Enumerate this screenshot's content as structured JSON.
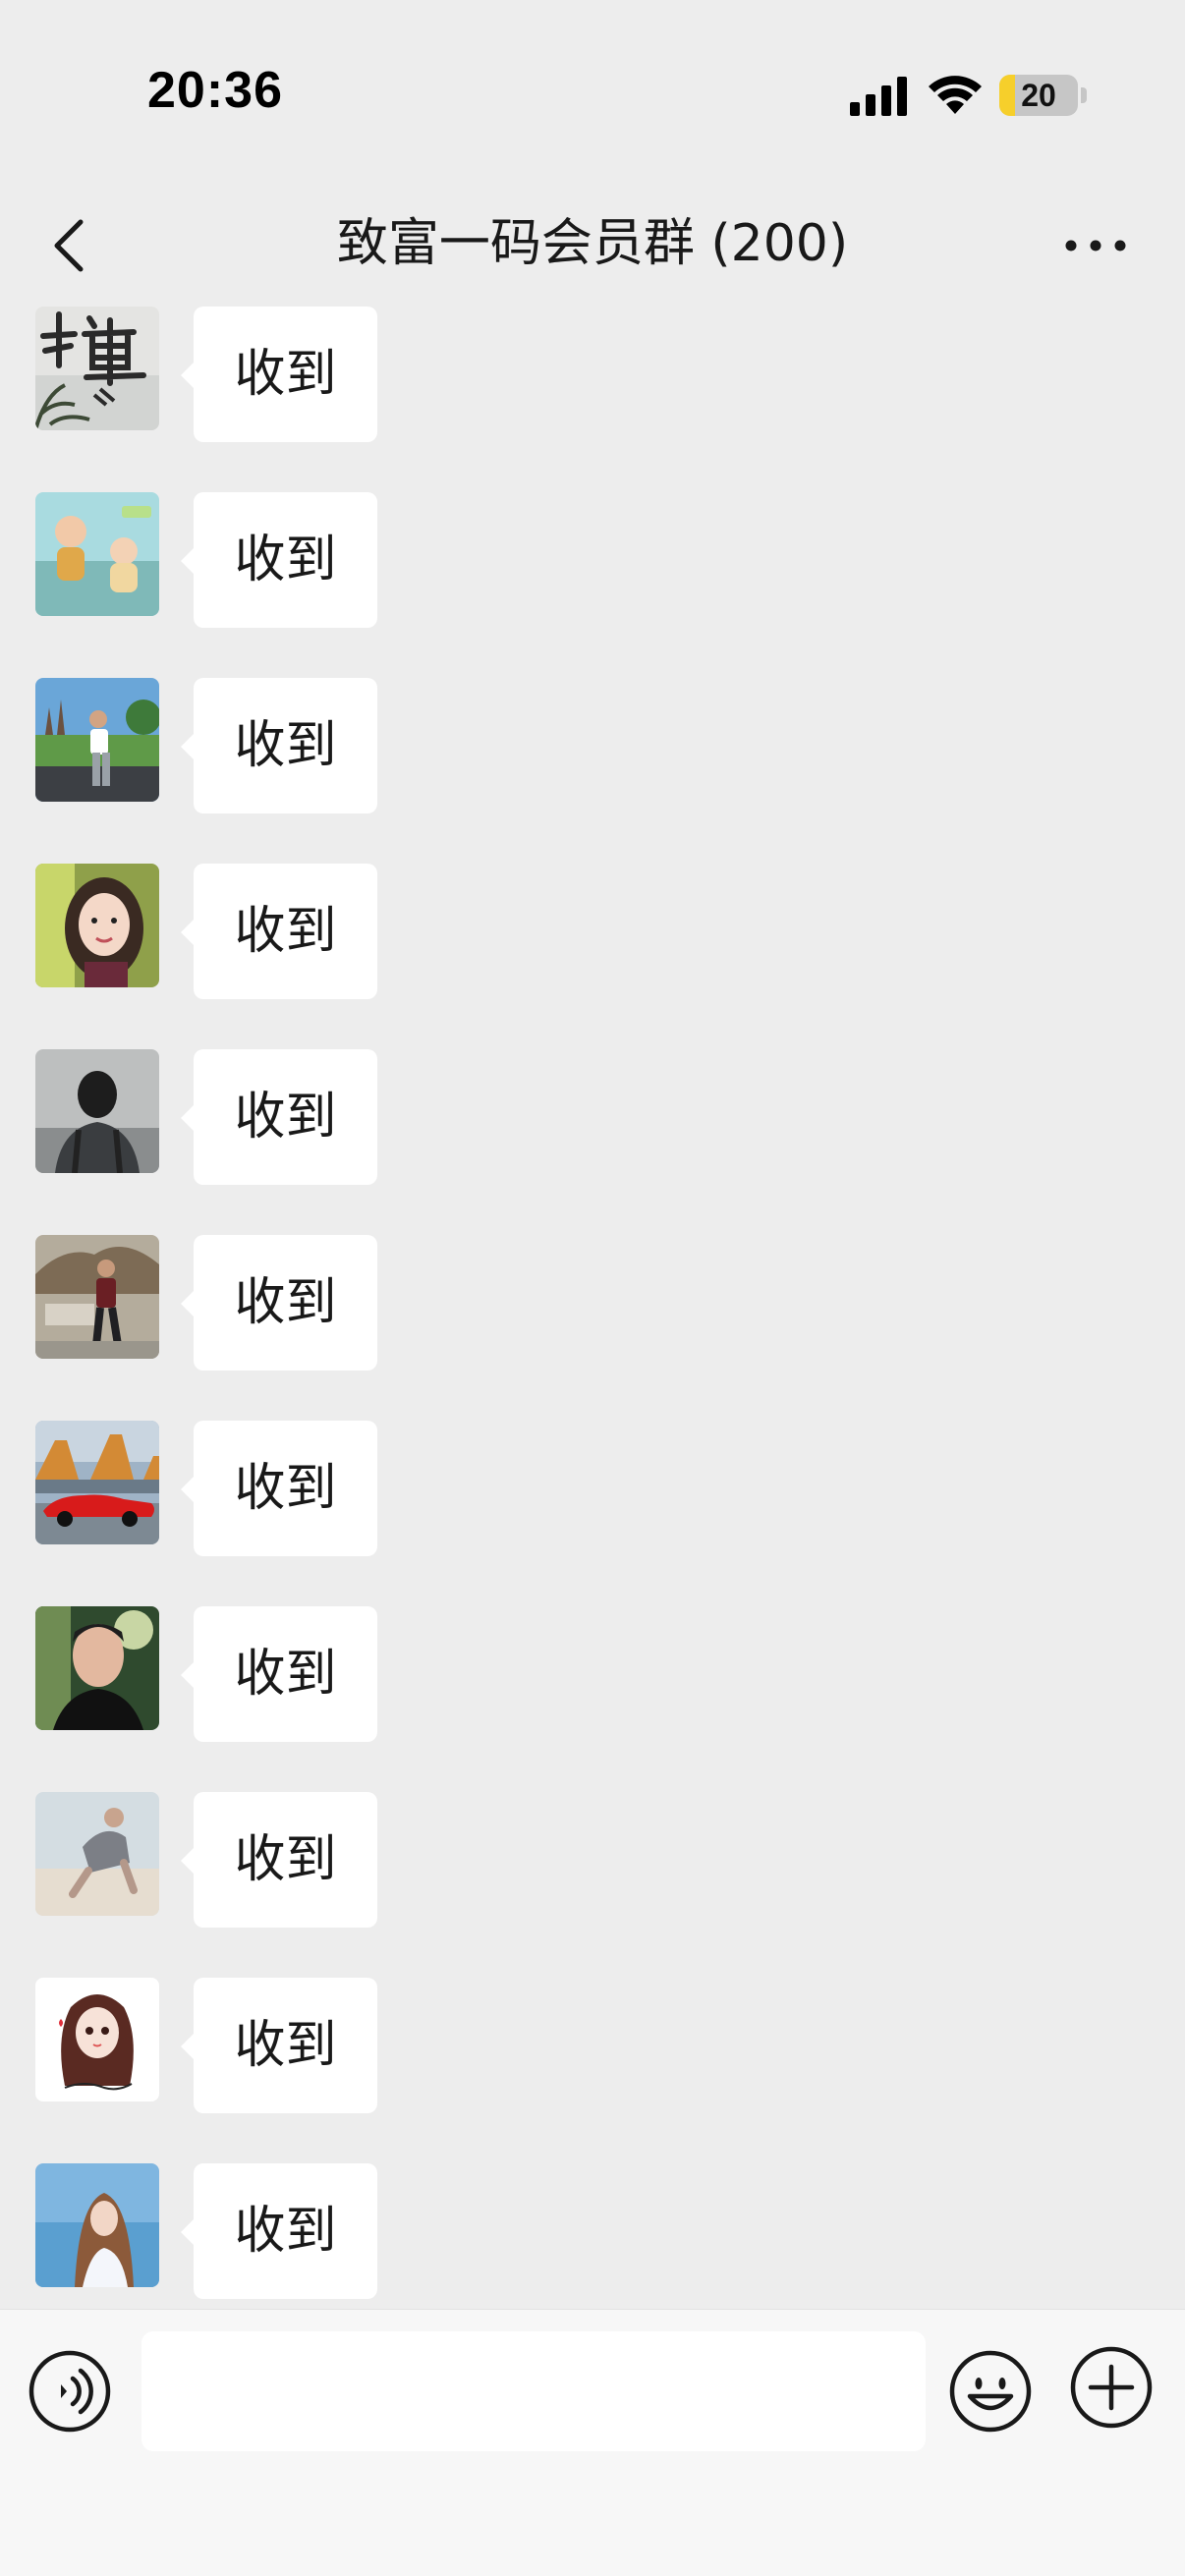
{
  "status_bar": {
    "time": "20:36",
    "battery_level": "20",
    "battery_fraction": 0.2
  },
  "nav": {
    "title": "致富一码会员群 (200)"
  },
  "messages": [
    {
      "text": "收到",
      "avatar": "calligraphy-chan-character"
    },
    {
      "text": "收到",
      "avatar": "two-babies-on-sofa"
    },
    {
      "text": "收到",
      "avatar": "man-sitting-park-palace"
    },
    {
      "text": "收到",
      "avatar": "woman-selfie"
    },
    {
      "text": "收到",
      "avatar": "man-back-view-city"
    },
    {
      "text": "收到",
      "avatar": "man-sitting-bench"
    },
    {
      "text": "收到",
      "avatar": "red-sports-car"
    },
    {
      "text": "收到",
      "avatar": "young-man-portrait"
    },
    {
      "text": "收到",
      "avatar": "man-crouching-beach"
    },
    {
      "text": "收到",
      "avatar": "cartoon-girl-illustration"
    },
    {
      "text": "收到",
      "avatar": "woman-by-sea"
    }
  ],
  "input_bar": {
    "voice_icon": "voice-icon",
    "emoji_icon": "emoji-icon",
    "plus_icon": "plus-icon",
    "input_value": ""
  },
  "colors": {
    "background": "#ededed",
    "bubble": "#ffffff",
    "text": "#191919",
    "battery_accent": "#f6cf2b"
  }
}
